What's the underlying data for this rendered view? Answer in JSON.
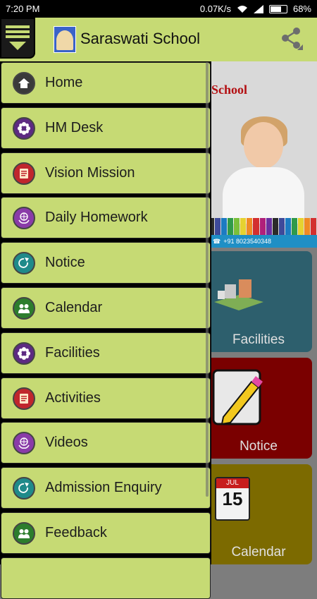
{
  "status_bar": {
    "time": "7:20 PM",
    "network_speed": "0.07K/s",
    "battery": "68%",
    "battery_level": 0.68
  },
  "app_bar": {
    "title": "Saraswati School",
    "menu_icon": "menu-icon",
    "share_icon": "share-icon"
  },
  "banner": {
    "title": "School",
    "phone": "+91 8023540348"
  },
  "tiles": [
    {
      "label": "Facilities",
      "color": "#2d5f6d",
      "icon": "facilities-icon"
    },
    {
      "label": "Notice",
      "color": "#7a0000",
      "icon": "notice-pencil-icon"
    },
    {
      "label": "Calendar",
      "color": "#7c6a00",
      "icon": "calendar-icon"
    }
  ],
  "calendar_tile": {
    "month": "JUL",
    "day": "15"
  },
  "drawer": {
    "items": [
      {
        "label": "Home",
        "icon": "home-icon",
        "icon_color": "#3a3a3a"
      },
      {
        "label": "HM Desk",
        "icon": "flower-icon",
        "icon_color": "#5d2a82"
      },
      {
        "label": "Vision Mission",
        "icon": "document-icon",
        "icon_color": "#c0262d"
      },
      {
        "label": "Daily Homework",
        "icon": "globe-hands-icon",
        "icon_color": "#8a3ba8"
      },
      {
        "label": "Notice",
        "icon": "share-arrow-icon",
        "icon_color": "#1f8a8a"
      },
      {
        "label": "Calendar",
        "icon": "people-icon",
        "icon_color": "#2d7d2d"
      },
      {
        "label": "Facilities",
        "icon": "flower-icon",
        "icon_color": "#5d2a82"
      },
      {
        "label": "Activities",
        "icon": "document-icon",
        "icon_color": "#c0262d"
      },
      {
        "label": "Videos",
        "icon": "globe-hands-icon",
        "icon_color": "#8a3ba8"
      },
      {
        "label": "Admission Enquiry",
        "icon": "share-arrow-icon",
        "icon_color": "#1f8a8a"
      },
      {
        "label": "Feedback",
        "icon": "people-icon",
        "icon_color": "#2d7d2d"
      },
      {
        "label": "",
        "icon": "",
        "icon_color": "#3a3a3a"
      }
    ]
  },
  "colors": {
    "app_bar": "#c6da74",
    "drawer_item": "#c6da74",
    "background": "#7d7d7d"
  }
}
